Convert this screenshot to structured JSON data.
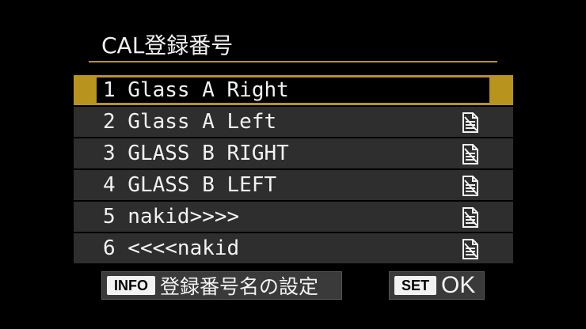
{
  "header": {
    "title": "CAL登録番号"
  },
  "list": {
    "items": [
      {
        "number": "1",
        "name": "Glass A Right",
        "label": "1 Glass A Right",
        "selected": true,
        "icon": "document-icon"
      },
      {
        "number": "2",
        "name": "Glass A Left",
        "label": "2 Glass A Left",
        "selected": false,
        "icon": "document-icon"
      },
      {
        "number": "3",
        "name": "GLASS B RIGHT",
        "label": "3 GLASS B RIGHT",
        "selected": false,
        "icon": "document-icon"
      },
      {
        "number": "4",
        "name": "GLASS B LEFT",
        "label": "4 GLASS B LEFT",
        "selected": false,
        "icon": "document-icon"
      },
      {
        "number": "5",
        "name": "nakid>>>>",
        "label": "5 nakid>>>>",
        "selected": false,
        "icon": "document-icon"
      },
      {
        "number": "6",
        "name": "<<<<nakid",
        "label": "6 <<<<nakid",
        "selected": false,
        "icon": "document-icon"
      }
    ]
  },
  "footer": {
    "info_key": "INFO",
    "info_label": "登録番号名の設定",
    "set_key": "SET",
    "set_label": "OK"
  },
  "colors": {
    "accent": "#b8941e",
    "row_bg": "#2e2e2e",
    "background": "#000000",
    "text": "#f2f2f2"
  }
}
